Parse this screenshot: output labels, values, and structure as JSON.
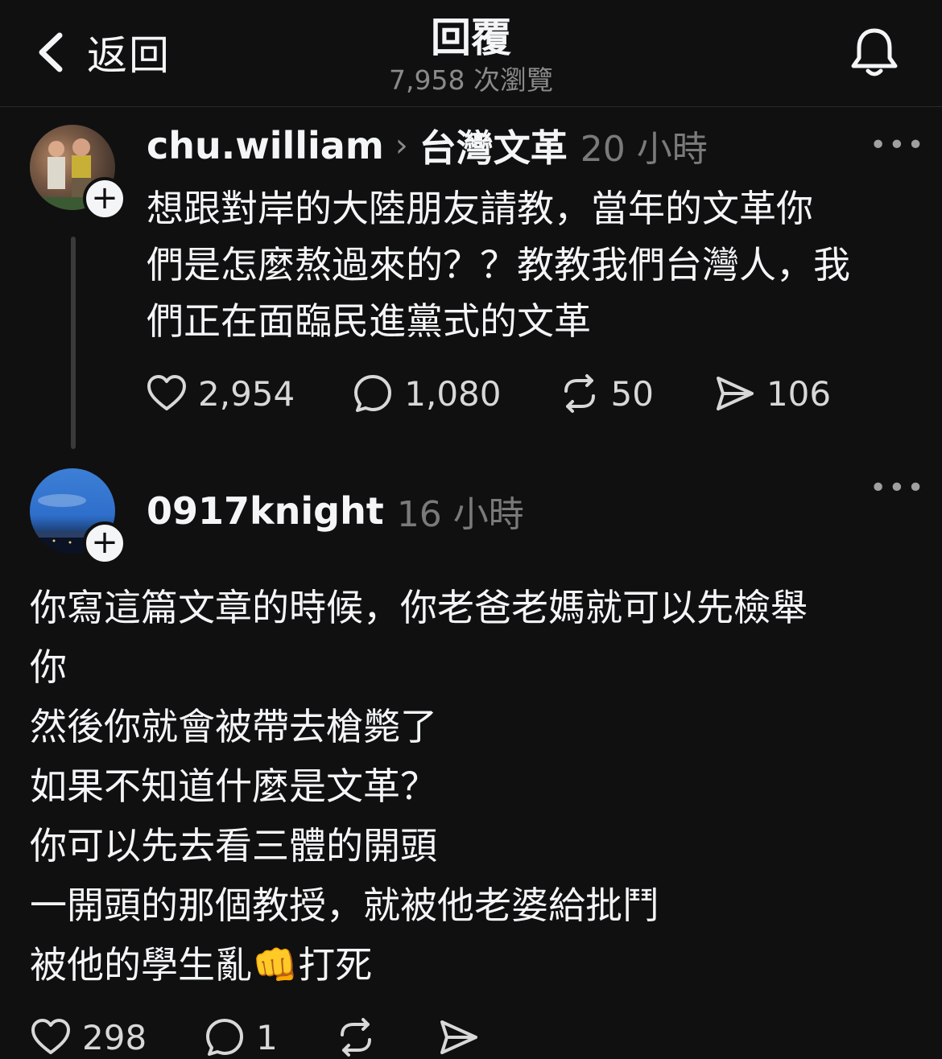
{
  "header": {
    "back_label": "返回",
    "title": "回覆",
    "views": "7,958 次瀏覽",
    "back_icon": "chevron-left-icon",
    "bell_icon": "bell-icon"
  },
  "posts": [
    {
      "username": "chu.william",
      "community": "台灣文革",
      "time": "20 小時",
      "text": "想跟對岸的大陸朋友請教，當年的文革你\n們是怎麼熬過來的？？教教我們台灣人，我\n們正在面臨民進黨式的文革",
      "likes": "2,954",
      "replies": "1,080",
      "reposts": "50",
      "shares": "106"
    },
    {
      "username": "0917knight",
      "time": "16 小時",
      "text": "你寫這篇文章的時候，你老爸老媽就可以先檢舉\n你\n然後你就會被帶去槍斃了\n如果不知道什麼是文革？\n你可以先去看三體的開頭\n一開頭的那個教授，就被他老婆給批鬥\n被他的學生亂👊打死",
      "likes": "298",
      "replies": "1"
    }
  ],
  "follow_symbol": "+",
  "more_symbol": "•••",
  "colors": {
    "background": "#101010",
    "text": "#f3f5f7",
    "muted": "#7a7a7a"
  }
}
